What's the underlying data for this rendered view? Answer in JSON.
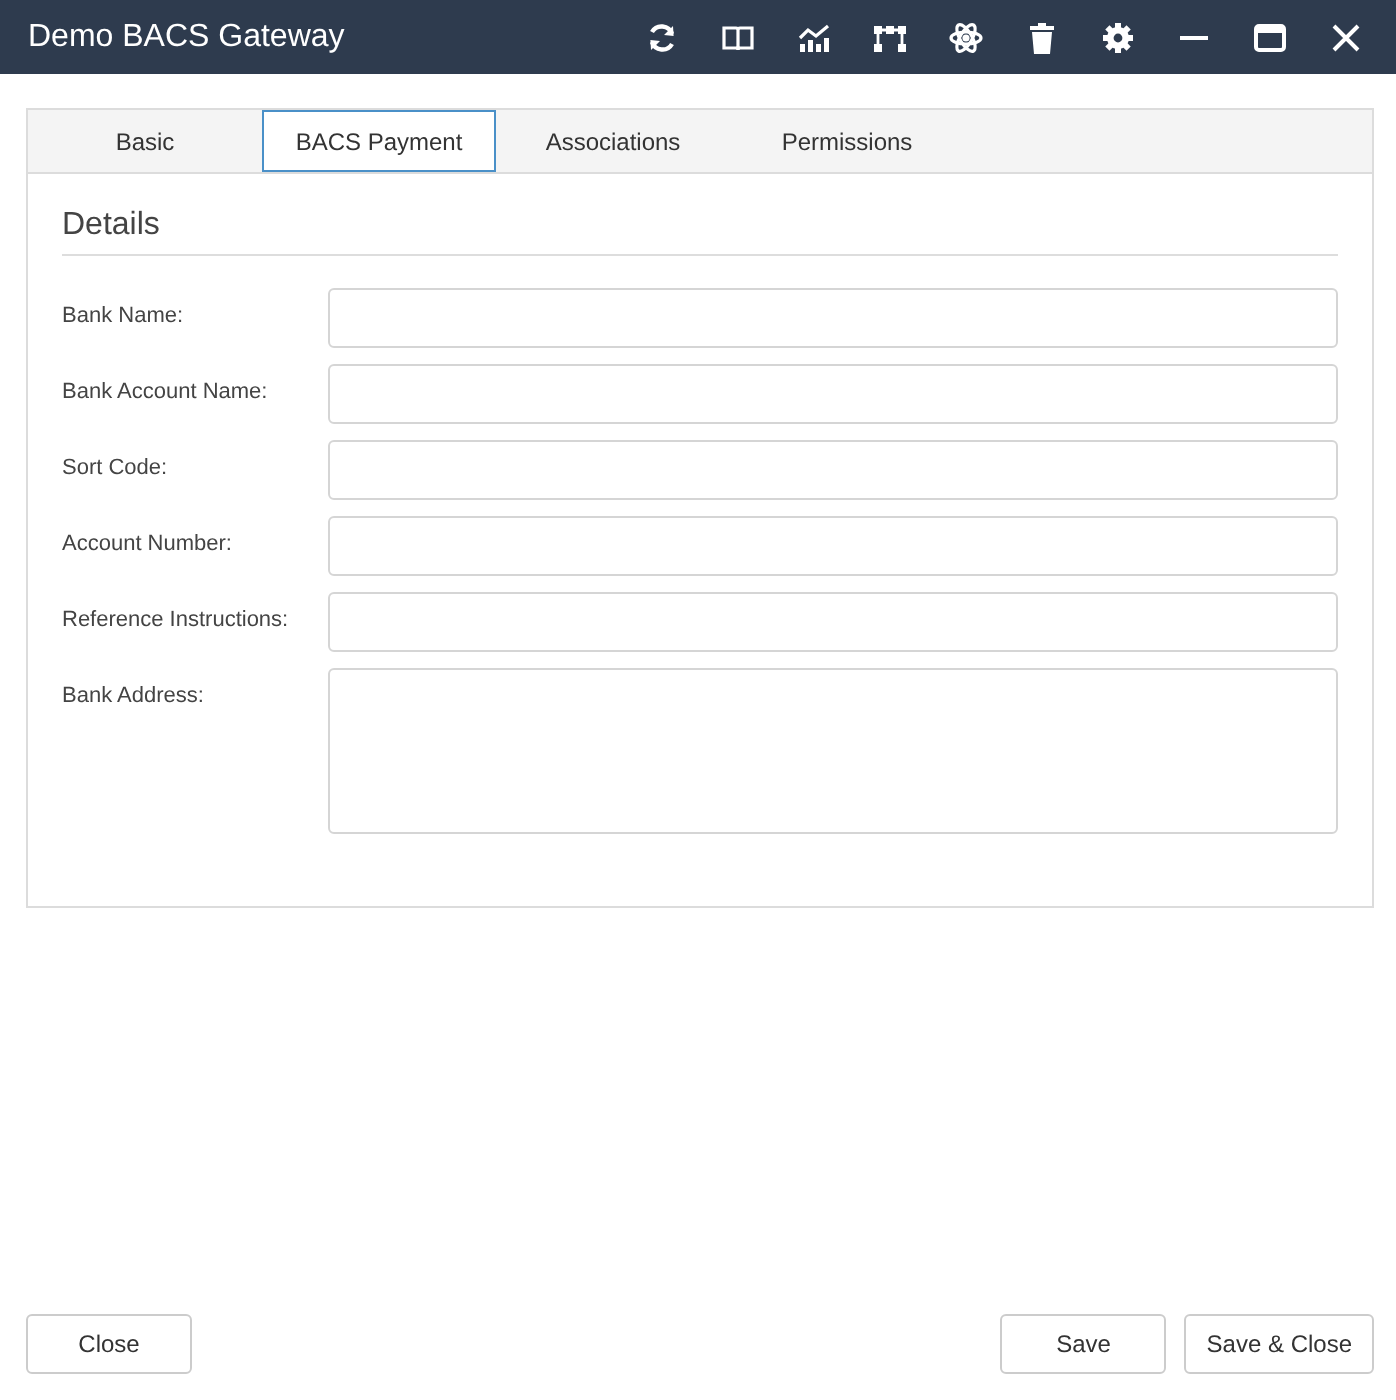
{
  "window": {
    "title": "Demo BACS Gateway"
  },
  "tabs": [
    {
      "label": "Basic",
      "selected": false
    },
    {
      "label": "BACS Payment",
      "selected": true
    },
    {
      "label": "Associations",
      "selected": false
    },
    {
      "label": "Permissions",
      "selected": false
    }
  ],
  "section": {
    "title": "Details"
  },
  "fields": [
    {
      "label": "Bank Name:",
      "kind": "text"
    },
    {
      "label": "Bank Account Name:",
      "kind": "text"
    },
    {
      "label": "Sort Code:",
      "kind": "text"
    },
    {
      "label": "Account Number:",
      "kind": "text"
    },
    {
      "label": "Reference Instructions:",
      "kind": "text"
    },
    {
      "label": "Bank Address:",
      "kind": "textarea"
    }
  ],
  "buttons_left": [
    "Close"
  ],
  "buttons_right": [
    "Save",
    "Save & Close"
  ]
}
